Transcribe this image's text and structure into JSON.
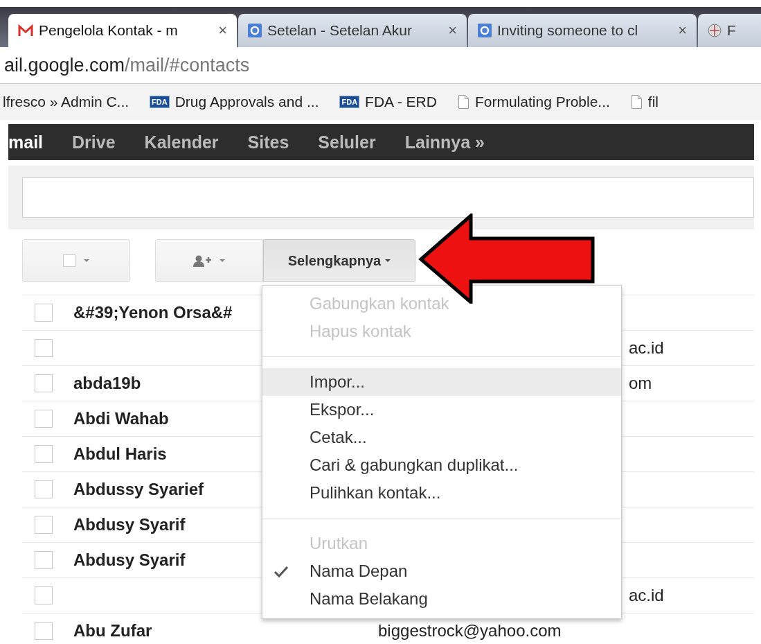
{
  "browser": {
    "tabs": [
      {
        "kind": "mail",
        "label": "Pengelola Kontak - m",
        "selected": true,
        "close": "×"
      },
      {
        "kind": "search",
        "label": "Setelan - Setelan Akur",
        "selected": false,
        "close": "×"
      },
      {
        "kind": "search",
        "label": "Inviting someone to cl",
        "selected": false,
        "close": "×"
      },
      {
        "kind": "site",
        "label": "F",
        "selected": false
      }
    ],
    "address": {
      "host": "ail.google.com",
      "path": "/mail/#contacts"
    },
    "bookmarks": [
      {
        "kind": "plain",
        "label": "lfresco » Admin C..."
      },
      {
        "kind": "badge",
        "badge": "FDA",
        "label": "Drug Approvals and ..."
      },
      {
        "kind": "badge",
        "badge": "FDA",
        "label": "FDA - ERD"
      },
      {
        "kind": "page",
        "label": "Formulating Proble..."
      },
      {
        "kind": "page",
        "label": "fil"
      }
    ]
  },
  "nav": [
    {
      "label": "mail",
      "selected": true
    },
    {
      "label": "Drive",
      "selected": false
    },
    {
      "label": "Kalender",
      "selected": false
    },
    {
      "label": "Sites",
      "selected": false
    },
    {
      "label": "Seluler",
      "selected": false
    },
    {
      "label": "Lainnya »",
      "selected": false
    }
  ],
  "toolbar": {
    "more_button": {
      "label": "Selengkapnya",
      "pressed": true
    }
  },
  "contacts": [
    {
      "name": "&#39;Yenon Orsa&#",
      "checked": false
    },
    {
      "checked": false,
      "email": {
        "text": "ac.id",
        "cut": true
      }
    },
    {
      "name": "abda19b",
      "checked": false,
      "email": {
        "text": "om",
        "cut": true
      }
    },
    {
      "name": "Abdi Wahab",
      "checked": false
    },
    {
      "name": "Abdul Haris",
      "checked": false
    },
    {
      "name": "Abdussy Syarief",
      "checked": false
    },
    {
      "name": "Abdusy Syarif",
      "checked": false
    },
    {
      "name": "Abdusy Syarif",
      "checked": false
    },
    {
      "checked": false,
      "email": {
        "text": "ac.id",
        "cut": true
      }
    },
    {
      "name": "Abu Zufar",
      "checked": false,
      "email": {
        "text": "biggestrock@yahoo.com",
        "cut": false
      }
    }
  ],
  "menu": [
    {
      "kind": "item",
      "label": "Gabungkan kontak",
      "disabled": true,
      "highlighted": false
    },
    {
      "kind": "item",
      "label": "Hapus kontak",
      "disabled": true,
      "highlighted": false
    },
    {
      "kind": "separator"
    },
    {
      "kind": "item",
      "label": "Impor...",
      "disabled": false,
      "highlighted": true
    },
    {
      "kind": "item",
      "label": "Ekspor...",
      "disabled": false,
      "highlighted": false
    },
    {
      "kind": "item",
      "label": "Cetak...",
      "disabled": false,
      "highlighted": false
    },
    {
      "kind": "item",
      "label": "Cari & gabungkan duplikat...",
      "disabled": false,
      "highlighted": false
    },
    {
      "kind": "item",
      "label": "Pulihkan kontak...",
      "disabled": false,
      "highlighted": false
    },
    {
      "kind": "separator"
    },
    {
      "kind": "heading",
      "label": "Urutkan"
    },
    {
      "kind": "check",
      "label": "Nama Depan",
      "checked": true
    },
    {
      "kind": "check",
      "label": "Nama Belakang",
      "checked": false
    }
  ]
}
